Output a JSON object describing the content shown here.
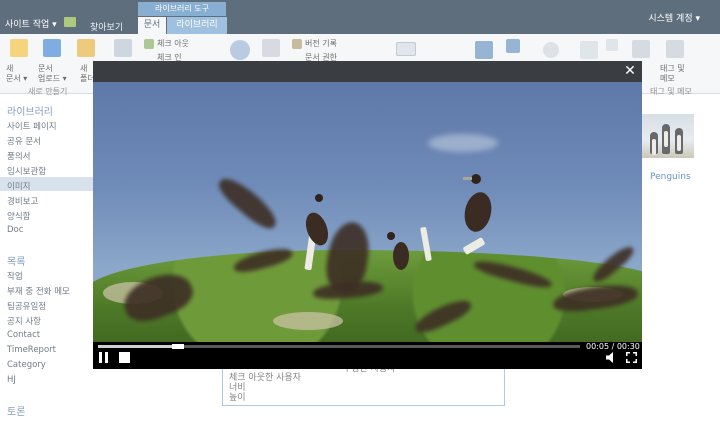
{
  "topbar": {
    "site_actions": "사이트 작업 ▾",
    "browse_tab": "찾아보기",
    "tools_label": "라이브러리 도구",
    "tab_documents": "문서",
    "tab_library": "라이브러리",
    "system_account": "시스템 계정 ▾"
  },
  "ribbon": {
    "new_doc": "새\n문서 ▾",
    "upload": "문서\n업로드 ▾",
    "new_folder": "새\n폴더",
    "checkout": "체크 아웃",
    "checkin": "체크 인",
    "version_history": "버전 기록",
    "permissions": "문서 권한",
    "tags_notes": "태그 및\n메모",
    "group_new": "새로 만들기",
    "group_tags": "태그 및 메모"
  },
  "left_nav": {
    "libraries_heading": "라이브러리",
    "libraries": [
      "사이트 페이지",
      "공유 문서",
      "품의서",
      "임시보관함",
      "이미지",
      "경비보고",
      "양식함",
      "Doc"
    ],
    "lists_heading": "목록",
    "lists": [
      "작업",
      "부재 중 전화 메모",
      "팀공유일정",
      "공지 사항",
      "Contact",
      "TimeReport",
      "Category",
      "HJ"
    ],
    "discussions_heading": "토론",
    "selected_index": 4
  },
  "main": {
    "penguins_link": "Penguins",
    "bg_line1": "체크 아웃한 사용자",
    "bg_line2": "너비",
    "bg_line3": "높이",
    "bg_right": "수정한 사용자"
  },
  "player": {
    "close_symbol": "✕",
    "time": "00:05 / 00:30",
    "progress": 0.167
  },
  "colors": {
    "topbar": "#21374c",
    "accent": "#5b8fc0",
    "link": "#2a6ab0"
  }
}
